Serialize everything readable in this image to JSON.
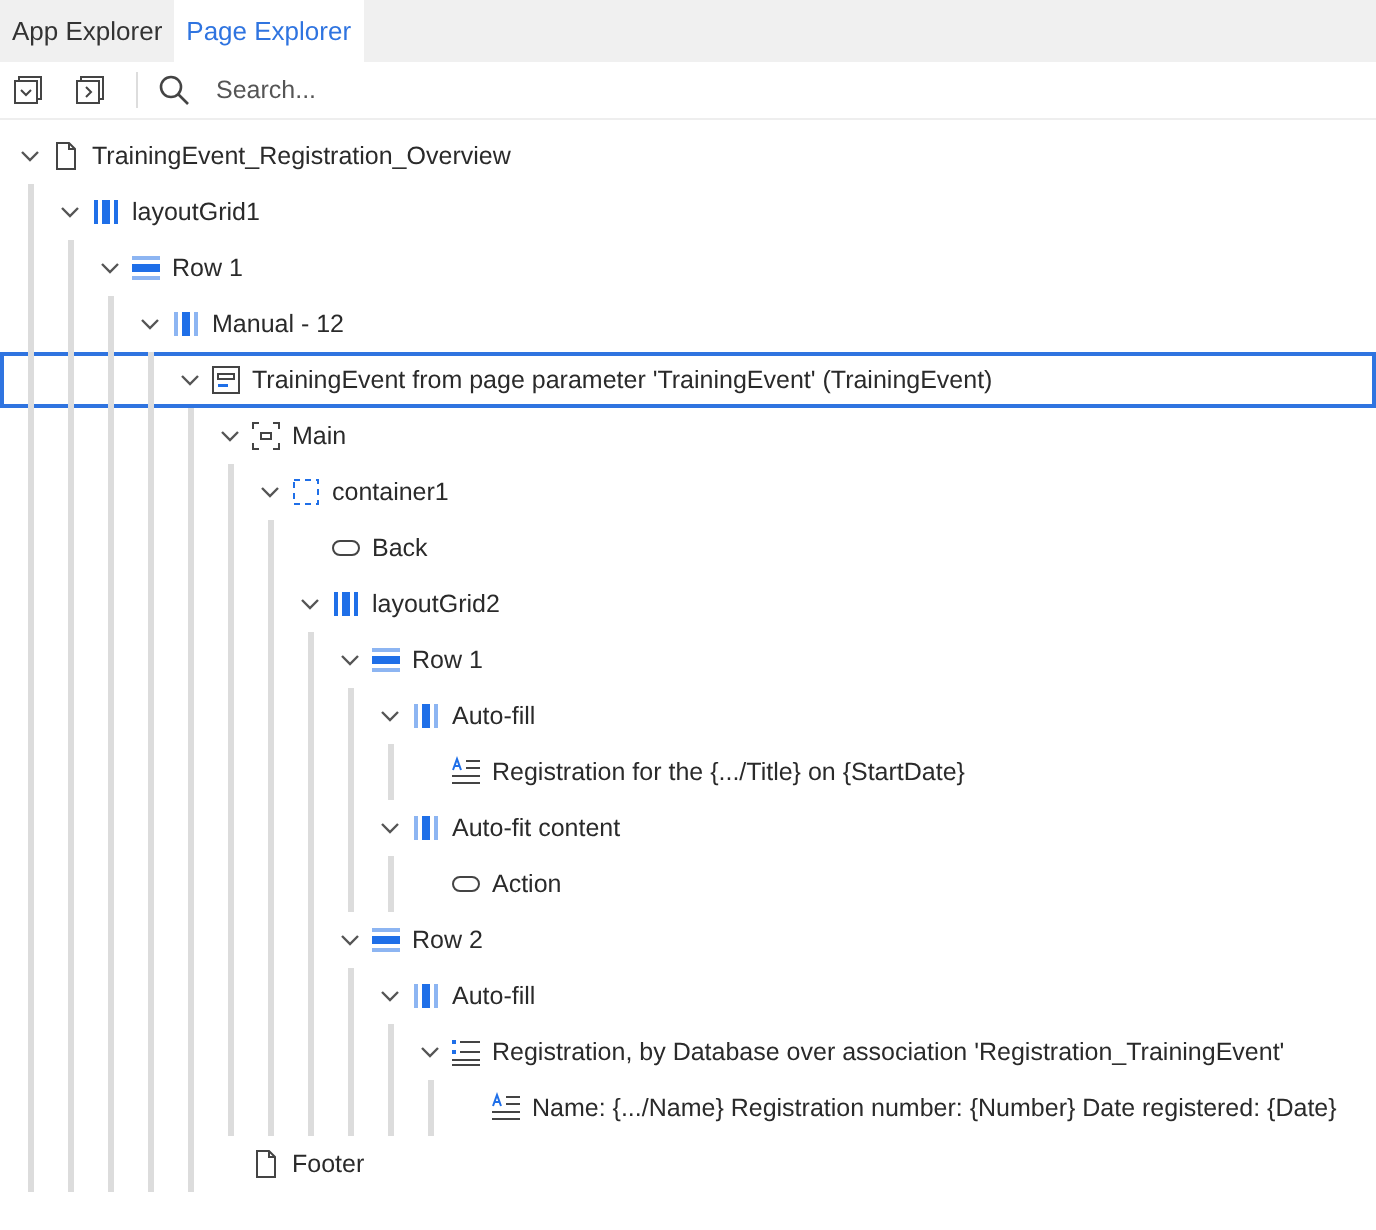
{
  "tabs": [
    {
      "label": "App Explorer",
      "selected": false
    },
    {
      "label": "Page Explorer",
      "selected": true
    }
  ],
  "toolbar": {
    "search": {
      "placeholder": "Search..."
    }
  },
  "tree": [
    {
      "kind": "page",
      "label": "TrainingEvent_Registration_Overview",
      "expanded": true,
      "selected": false,
      "children": [
        {
          "kind": "grid",
          "label": "layoutGrid1",
          "expanded": true,
          "selected": false,
          "children": [
            {
              "kind": "row",
              "label": "Row 1",
              "expanded": true,
              "selected": false,
              "children": [
                {
                  "kind": "column",
                  "label": "Manual - 12",
                  "expanded": true,
                  "selected": false,
                  "children": [
                    {
                      "kind": "dataview",
                      "label": "TrainingEvent from page parameter 'TrainingEvent' (TrainingEvent)",
                      "expanded": true,
                      "selected": true,
                      "children": [
                        {
                          "kind": "main",
                          "label": "Main",
                          "expanded": true,
                          "selected": false,
                          "children": [
                            {
                              "kind": "container",
                              "label": "container1",
                              "expanded": true,
                              "selected": false,
                              "children": [
                                {
                                  "kind": "button",
                                  "label": "Back",
                                  "selected": false
                                },
                                {
                                  "kind": "grid",
                                  "label": "layoutGrid2",
                                  "expanded": true,
                                  "selected": false,
                                  "children": [
                                    {
                                      "kind": "row",
                                      "label": "Row 1",
                                      "expanded": true,
                                      "selected": false,
                                      "children": [
                                        {
                                          "kind": "column",
                                          "label": "Auto-fill",
                                          "expanded": true,
                                          "selected": false,
                                          "children": [
                                            {
                                              "kind": "text",
                                              "label": "Registration for the {.../Title} on {StartDate}",
                                              "selected": false
                                            }
                                          ]
                                        },
                                        {
                                          "kind": "column",
                                          "label": "Auto-fit content",
                                          "expanded": true,
                                          "selected": false,
                                          "children": [
                                            {
                                              "kind": "button",
                                              "label": "Action",
                                              "selected": false
                                            }
                                          ]
                                        }
                                      ]
                                    },
                                    {
                                      "kind": "row",
                                      "label": "Row 2",
                                      "expanded": true,
                                      "selected": false,
                                      "children": [
                                        {
                                          "kind": "column",
                                          "label": "Auto-fill",
                                          "expanded": true,
                                          "selected": false,
                                          "children": [
                                            {
                                              "kind": "list",
                                              "label": "Registration, by Database over association 'Registration_TrainingEvent'",
                                              "expanded": true,
                                              "selected": false,
                                              "children": [
                                                {
                                                  "kind": "text",
                                                  "label": "Name: {.../Name} Registration number: {Number} Date registered: {Date}",
                                                  "selected": false
                                                }
                                              ]
                                            }
                                          ]
                                        }
                                      ]
                                    }
                                  ]
                                }
                              ]
                            }
                          ]
                        },
                        {
                          "kind": "page",
                          "label": "Footer",
                          "selected": false
                        }
                      ]
                    }
                  ]
                }
              ]
            }
          ]
        }
      ]
    }
  ]
}
